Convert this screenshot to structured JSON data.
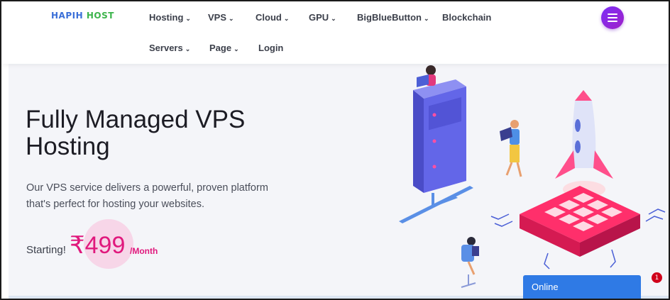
{
  "header": {
    "logo_part1": "HAPIH",
    "logo_part2": " HOST",
    "nav": [
      {
        "label": "Hosting",
        "has_dropdown": true
      },
      {
        "label": "VPS",
        "has_dropdown": true
      },
      {
        "label": "Cloud",
        "has_dropdown": true
      },
      {
        "label": "GPU",
        "has_dropdown": true
      },
      {
        "label": "BigBlueButton",
        "has_dropdown": true
      },
      {
        "label": "Blockchain",
        "has_dropdown": false
      },
      {
        "label": "Servers",
        "has_dropdown": true
      },
      {
        "label": "Page",
        "has_dropdown": true
      },
      {
        "label": "Login",
        "has_dropdown": false
      }
    ],
    "menu_icon": "hamburger-icon"
  },
  "hero": {
    "title_line1": "Fully Managed VPS",
    "title_line2": "Hosting",
    "desc_line1": "Our VPS service delivers a powerful, proven platform",
    "desc_line2": "that's perfect for hosting your websites.",
    "price_label": "Starting!",
    "price_value": "₹499",
    "price_unit": "/Month"
  },
  "chat": {
    "label": "Online",
    "badge_count": "1"
  },
  "colors": {
    "accent_pink": "#e0197d",
    "menu_purple": "#7b2ff7",
    "chat_blue": "#2f7ae5",
    "logo_blue": "#3a6fd8",
    "logo_green": "#3cb44b"
  }
}
